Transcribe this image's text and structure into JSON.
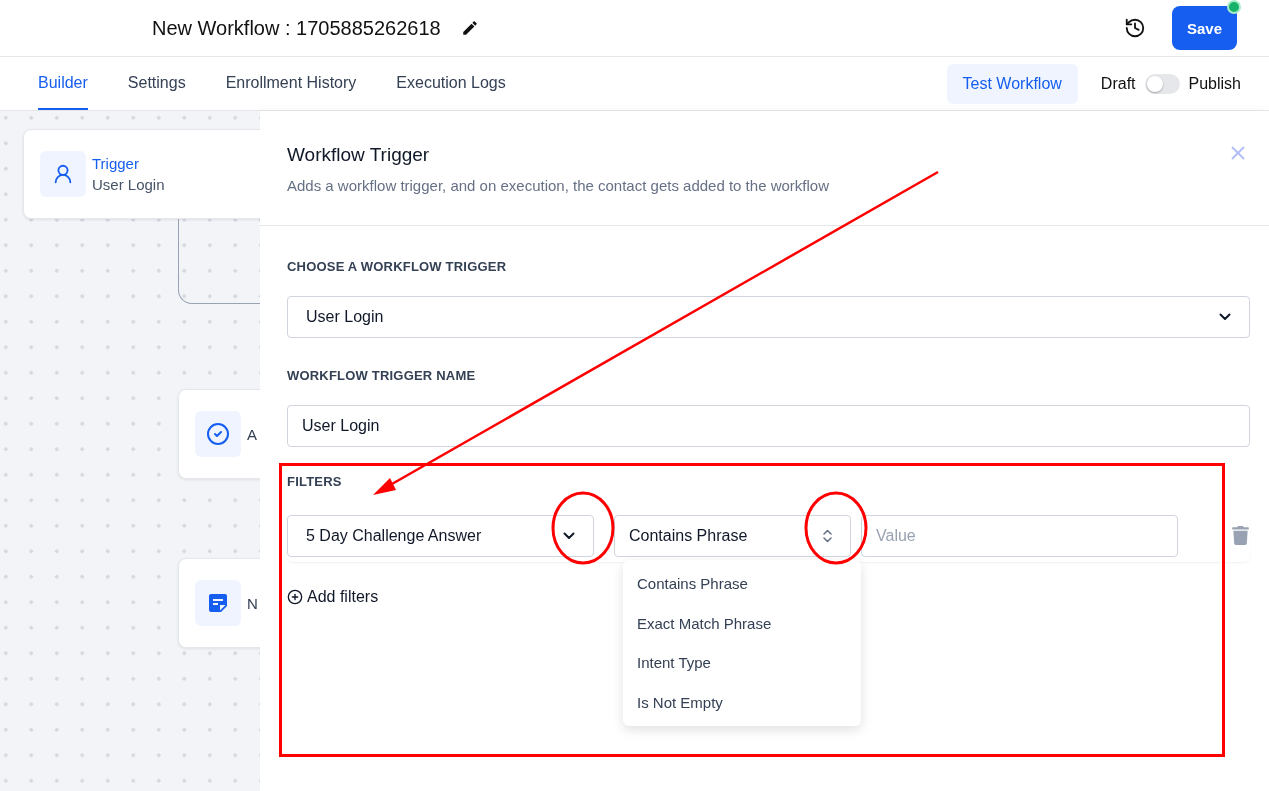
{
  "header": {
    "title": "New Workflow : 1705885262618",
    "save": "Save",
    "save_badge": true
  },
  "tabs": [
    {
      "label": "Builder",
      "selected": true
    },
    {
      "label": "Settings",
      "selected": false
    },
    {
      "label": "Enrollment History",
      "selected": false
    },
    {
      "label": "Execution Logs",
      "selected": false
    }
  ],
  "test_button": "Test Workflow",
  "publish_toggle": {
    "off_label": "Draft",
    "on_label": "Publish",
    "on": false
  },
  "canvas_nodes": [
    {
      "kind": "trigger",
      "title": "Trigger",
      "subtitle": "User Login"
    },
    {
      "kind": "action",
      "title": "A"
    },
    {
      "kind": "note",
      "title": "N"
    }
  ],
  "panel": {
    "title": "Workflow Trigger",
    "description": "Adds a workflow trigger, and on execution, the contact gets added to the workflow",
    "trigger_label": "CHOOSE A WORKFLOW TRIGGER",
    "trigger_value": "User Login",
    "name_label": "WORKFLOW TRIGGER NAME",
    "name_value": "User Login",
    "filters_label": "FILTERS",
    "filter": {
      "field": "5 Day Challenge Answer",
      "operator": "Contains Phrase",
      "value_placeholder": "Value"
    },
    "operator_options": [
      "Contains Phrase",
      "Exact Match Phrase",
      "Intent Type",
      "Is Not Empty"
    ],
    "add_filters": "Add filters"
  },
  "annotations": [
    {
      "kind": "box"
    },
    {
      "kind": "circle"
    },
    {
      "kind": "circle"
    },
    {
      "kind": "arrow"
    }
  ]
}
